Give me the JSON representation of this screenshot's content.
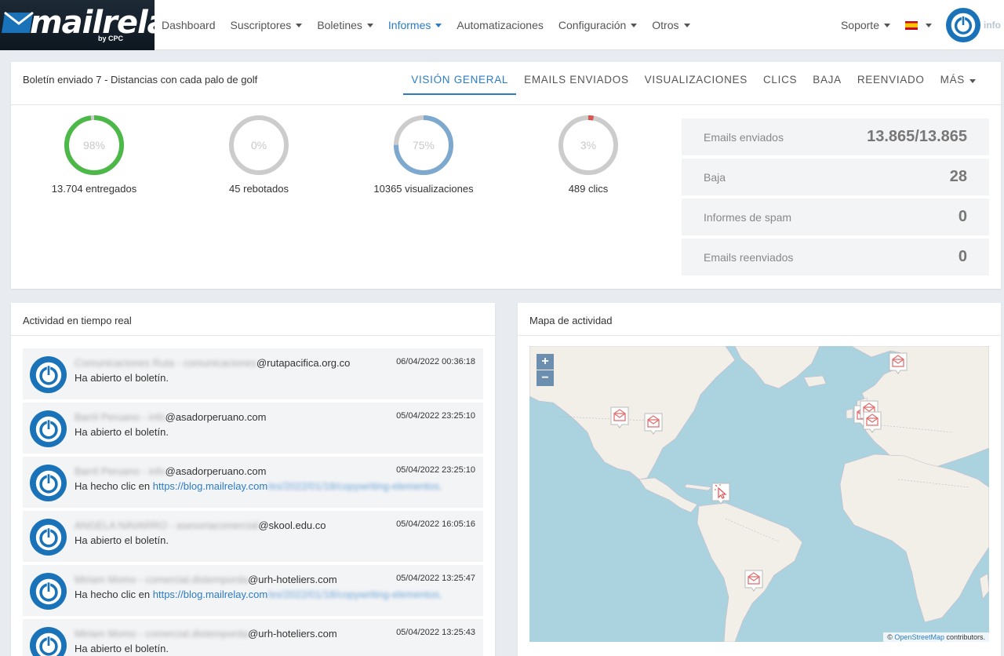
{
  "brand": {
    "logo": "mailrelay",
    "logo_sub": "by CPC"
  },
  "nav": {
    "items": [
      {
        "label": "Dashboard",
        "dropdown": false,
        "active": false
      },
      {
        "label": "Suscriptores",
        "dropdown": true,
        "active": false
      },
      {
        "label": "Boletines",
        "dropdown": true,
        "active": false
      },
      {
        "label": "Informes",
        "dropdown": true,
        "active": true
      },
      {
        "label": "Automatizaciones",
        "dropdown": false,
        "active": false
      },
      {
        "label": "Configuración",
        "dropdown": true,
        "active": false
      },
      {
        "label": "Otros",
        "dropdown": true,
        "active": false
      }
    ],
    "support": "Soporte",
    "user_label": "info"
  },
  "report": {
    "title": "Boletín enviado  7 - Distancias con cada palo de golf",
    "tabs": [
      "VISIÓN GENERAL",
      "EMAILS ENVIADOS",
      "VISUALIZACIONES",
      "CLICS",
      "BAJA",
      "REENVIADO",
      "MÁS"
    ],
    "active_tab": 0,
    "gauges": [
      {
        "percent_label": "98%",
        "value": 0.98,
        "color": "#4cb848",
        "label": "13.704 entregados"
      },
      {
        "percent_label": "0%",
        "value": 0.0,
        "color": "#cccccc",
        "label": "45 rebotados"
      },
      {
        "percent_label": "75%",
        "value": 0.75,
        "color": "#7ea9cf",
        "label": "10365 visualizaciones"
      },
      {
        "percent_label": "3%",
        "value": 0.03,
        "color": "#d9534f",
        "label": "489 clics"
      }
    ],
    "stats": [
      {
        "label": "Emails enviados",
        "value": "13.865/13.865"
      },
      {
        "label": "Baja",
        "value": "28"
      },
      {
        "label": "Informes de spam",
        "value": "0"
      },
      {
        "label": "Emails reenviados",
        "value": "0"
      }
    ]
  },
  "activity": {
    "title": "Actividad en tiempo real",
    "items": [
      {
        "name_blur": "Comunicaciones Ruta - comunicaciones",
        "email": "@rutapacifica.org.co",
        "date": "06/04/2022 00:36:18",
        "action": "Ha abierto el boletín.",
        "link": "",
        "link_blur": ""
      },
      {
        "name_blur": "Barril Peruano - info",
        "email": "@asadorperuano.com",
        "date": "05/04/2022 23:25:10",
        "action": "Ha abierto el boletín.",
        "link": "",
        "link_blur": ""
      },
      {
        "name_blur": "Barril Peruano - info",
        "email": "@asadorperuano.com",
        "date": "05/04/2022 23:25:10",
        "action": "Ha hecho clic en ",
        "link": "https://blog.mailrelay.com",
        "link_blur": "/es/2022/01/18/copywriting-elementos."
      },
      {
        "name_blur": "ANGELA NAVARRO - asesoriacomercial",
        "email": "@skool.edu.co",
        "date": "05/04/2022 16:05:16",
        "action": "Ha abierto el boletín.",
        "link": "",
        "link_blur": ""
      },
      {
        "name_blur": "Miriam Momo - comercial.distemporda",
        "email": "@urh-hoteliers.com",
        "date": "05/04/2022 13:25:47",
        "action": "Ha hecho clic en ",
        "link": "https://blog.mailrelay.com",
        "link_blur": "/es/2022/01/18/copywriting-elementos."
      },
      {
        "name_blur": "Miriam Momo - comercial.distemporda",
        "email": "@urh-hoteliers.com",
        "date": "05/04/2022 13:25:43",
        "action": "Ha abierto el boletín.",
        "link": "",
        "link_blur": ""
      }
    ]
  },
  "map": {
    "title": "Mapa de actividad",
    "zoom_in": "+",
    "zoom_out": "−",
    "attribution_prefix": "© ",
    "attribution_link": "OpenStreetMap",
    "attribution_suffix": " contributors."
  },
  "colors": {
    "accent": "#2a7cc7",
    "avatar": "#1a73b8",
    "water": "#aad3df",
    "land": "#f2efe9"
  }
}
